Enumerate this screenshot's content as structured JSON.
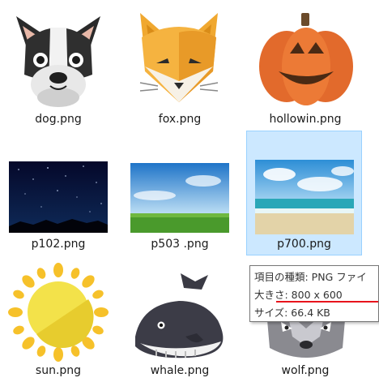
{
  "files": [
    {
      "name": "dog.png",
      "icon": "dog-icon"
    },
    {
      "name": "fox.png",
      "icon": "fox-icon"
    },
    {
      "name": "hollowin.png",
      "icon": "pumpkin-icon"
    },
    {
      "name": "p102.png",
      "icon": "night-sky-image"
    },
    {
      "name": "p503 .png",
      "icon": "field-sky-image"
    },
    {
      "name": "p700.png",
      "icon": "beach-image",
      "selected": true
    },
    {
      "name": "sun.png",
      "icon": "sun-icon"
    },
    {
      "name": "whale.png",
      "icon": "whale-icon"
    },
    {
      "name": "wolf.png",
      "icon": "wolf-icon"
    }
  ],
  "tooltip": {
    "line1": "項目の種類: PNG ファイ",
    "line2": "大きさ: 800 x 600",
    "line3": "サイズ: 66.4 KB"
  },
  "colors": {
    "selection_bg": "#cce8ff",
    "selection_border": "#99d1ff",
    "annotation_red": "#e8141c"
  }
}
